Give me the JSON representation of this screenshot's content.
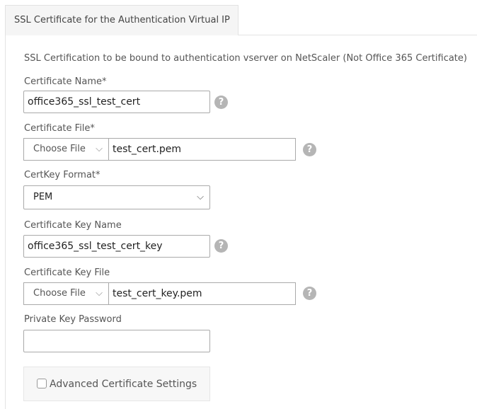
{
  "tab": {
    "label": "SSL Certificate for the Authentication Virtual IP"
  },
  "description": "SSL Certification to be bound to authentication vserver on NetScaler (Not Office 365 Certificate)",
  "fields": {
    "cert_name": {
      "label": "Certificate Name*",
      "value": "office365_ssl_test_cert"
    },
    "cert_file": {
      "label": "Certificate File*",
      "button": "Choose File",
      "value": "test_cert.pem"
    },
    "certkey_format": {
      "label": "CertKey Format*",
      "value": "PEM"
    },
    "cert_key_name": {
      "label": "Certificate Key Name",
      "value": "office365_ssl_test_cert_key"
    },
    "cert_key_file": {
      "label": "Certificate Key File",
      "button": "Choose File",
      "value": "test_cert_key.pem"
    },
    "private_key_password": {
      "label": "Private Key Password",
      "value": ""
    }
  },
  "advanced": {
    "label": "Advanced Certificate Settings",
    "checked": false
  },
  "help_glyph": "?",
  "chevron_glyph": "⌵"
}
